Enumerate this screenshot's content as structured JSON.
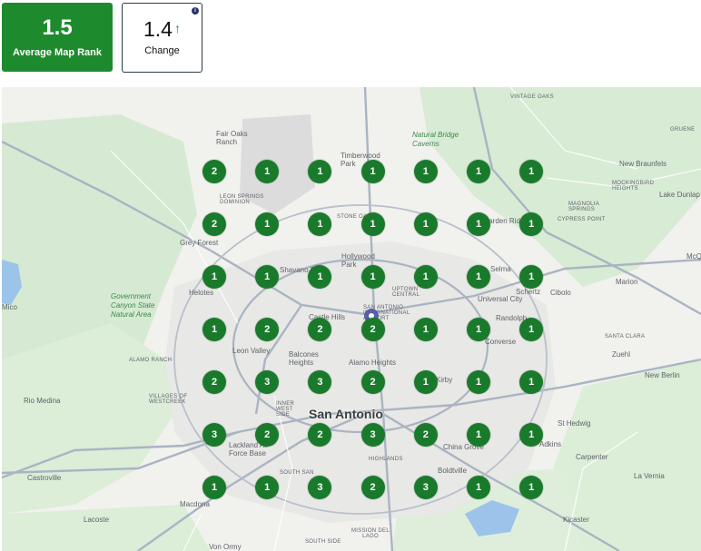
{
  "summary": {
    "average_map_rank": {
      "value": "1.5",
      "label": "Average Map Rank"
    },
    "change": {
      "value": "1.4",
      "label": "Change",
      "direction": "up",
      "info_icon": "info-icon"
    }
  },
  "colors": {
    "rank_pin": "#1a7a2c",
    "card_green": "#1e8a2e",
    "target_marker": "#5b5ea6"
  },
  "map": {
    "center_label": "San Antonio",
    "place_labels": [
      "VINTAGE OAKS",
      "Fair Oaks Ranch",
      "Timberwood Park",
      "Natural Bridge Caverns",
      "New Braunfels",
      "GRUENE",
      "MOCKINGBIRD HEIGHTS",
      "Lake Dunlap",
      "LEON SPRINGS DOMINION",
      "STONE OAK",
      "Garden Ridge",
      "MAGNOLIA SPRINGS",
      "CYPRESS POINT",
      "Grey Forest",
      "Hollywood Park",
      "Selma",
      "Shavano Park",
      "Schertz",
      "Cibolo",
      "Helotes",
      "UPTOWN CENTRAL",
      "Universal City",
      "Marion",
      "Government Canyon State Natural Area",
      "Mico",
      "SAN ANTONIO INTERNATIONAL AIRPORT",
      "Kirby",
      "Randolph",
      "Leon Valley",
      "Castle Hills",
      "Converse",
      "SANTA CLARA",
      "Balcones Heights",
      "Alamo Heights",
      "Zuehl",
      "ALAMO RANCH",
      "New Berlin",
      "Rio Medina",
      "VILLAGES OF WESTCREEK",
      "INNER WEST SIDE",
      "St Hedwig",
      "Lackland Air Force Base",
      "China Grove",
      "Adkins",
      "Carpenter",
      "Castroville",
      "SOUTH SAN",
      "HIGHLANDS",
      "Boldtville",
      "La Vernia",
      "Macdona",
      "Lacoste",
      "Von Ormy",
      "SOUTH SIDE",
      "MISSION DEL LAGO",
      "Kicaster",
      "McQ"
    ],
    "grid": [
      [
        2,
        1,
        1,
        1,
        1,
        1,
        1
      ],
      [
        2,
        1,
        1,
        1,
        1,
        1,
        1
      ],
      [
        1,
        1,
        1,
        1,
        1,
        1,
        1
      ],
      [
        1,
        2,
        2,
        2,
        1,
        1,
        1
      ],
      [
        2,
        3,
        3,
        2,
        1,
        1,
        1
      ],
      [
        3,
        2,
        2,
        3,
        2,
        1,
        1
      ],
      [
        1,
        1,
        3,
        2,
        3,
        1,
        1
      ]
    ]
  }
}
